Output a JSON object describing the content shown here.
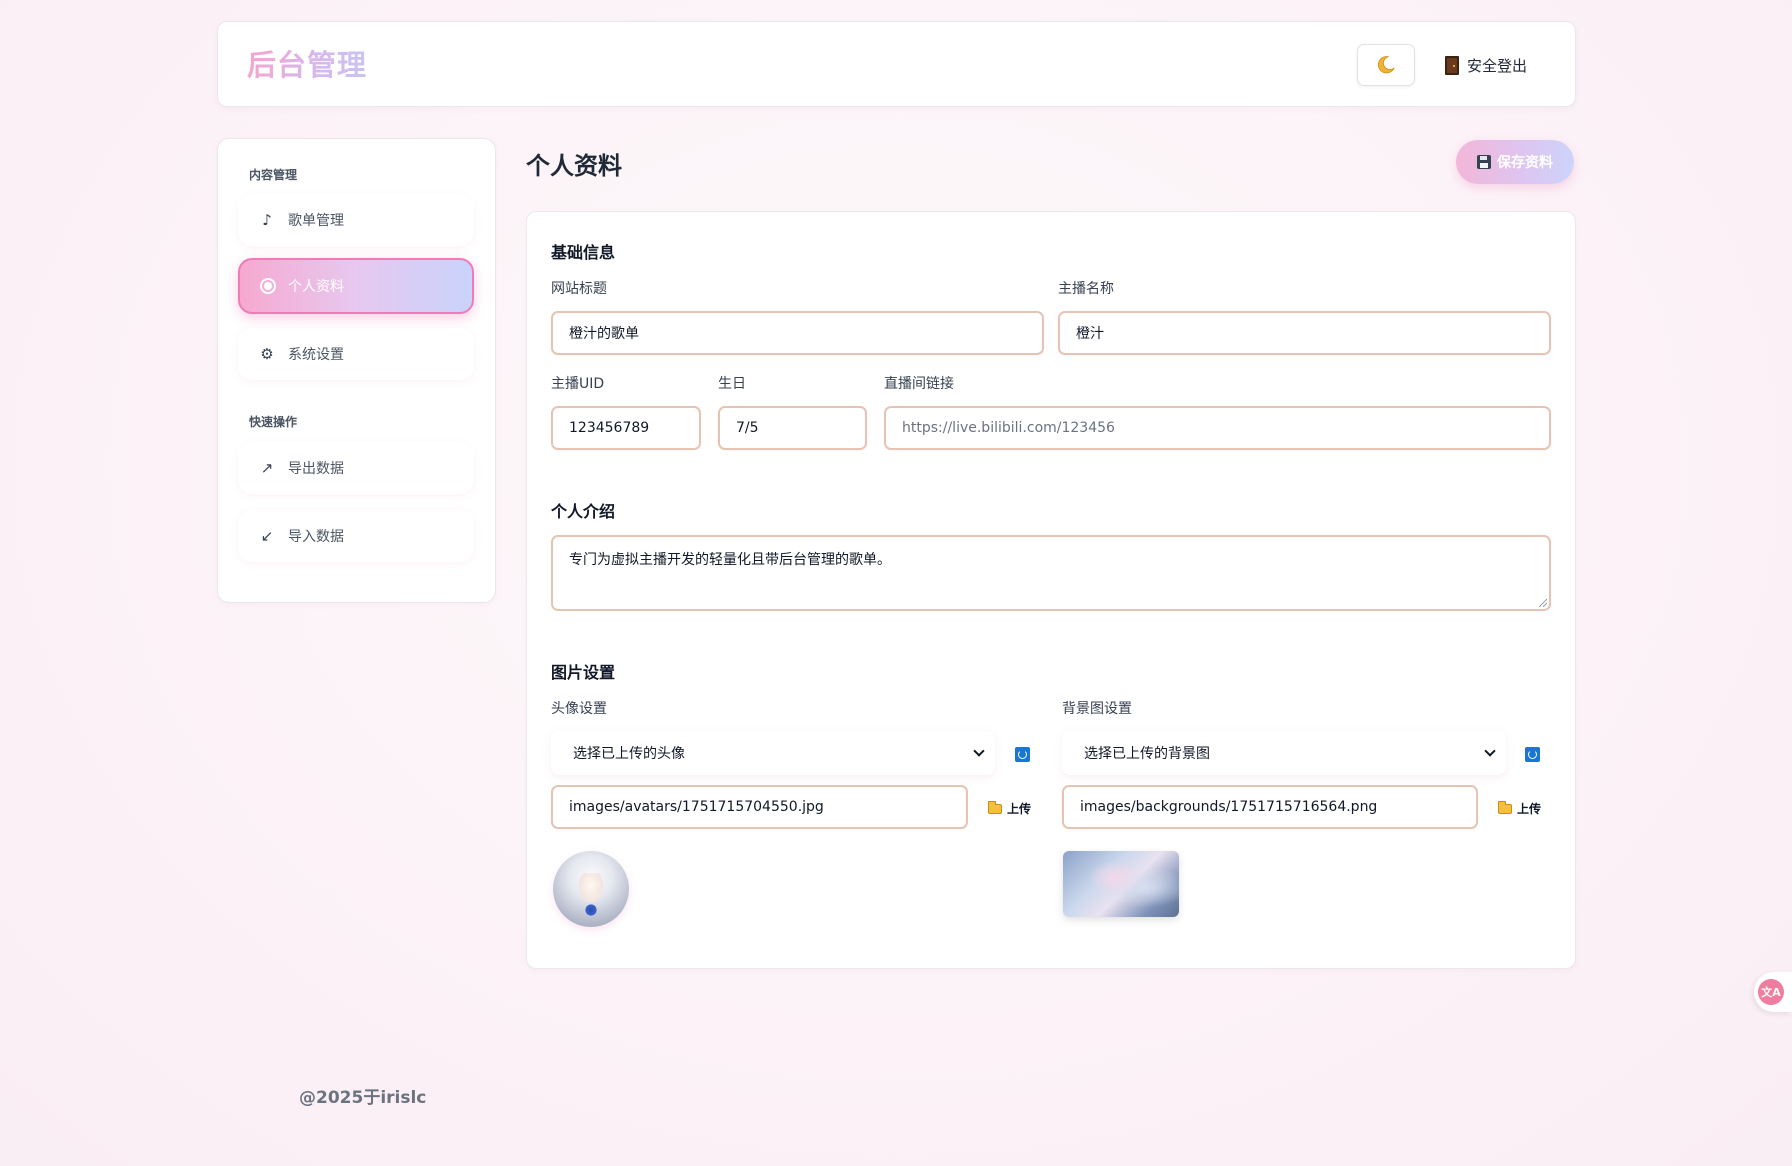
{
  "header": {
    "brand": "后台管理",
    "theme_toggle_icon": "moon-icon",
    "logout_label": "安全登出"
  },
  "sidebar": {
    "sections": [
      {
        "title": "内容管理"
      },
      {
        "title": "快速操作"
      }
    ],
    "items": [
      {
        "label": "歌单管理",
        "icon": "music-note-icon",
        "glyph": "♪"
      },
      {
        "label": "个人资料",
        "icon": "radio-icon",
        "glyph": ""
      },
      {
        "label": "系统设置",
        "icon": "gear-icon",
        "glyph": "⚙"
      },
      {
        "label": "导出数据",
        "icon": "arrow-up-right-icon",
        "glyph": "↗"
      },
      {
        "label": "导入数据",
        "icon": "arrow-down-left-icon",
        "glyph": "↙"
      }
    ],
    "active_index": 1
  },
  "main": {
    "title": "个人资料",
    "save_label": "保存资料",
    "basic": {
      "title": "基础信息",
      "site_title_label": "网站标题",
      "site_title_value": "橙汁的歌单",
      "streamer_name_label": "主播名称",
      "streamer_name_value": "橙汁",
      "uid_label": "主播UID",
      "uid_value": "123456789",
      "birthday_label": "生日",
      "birthday_value": "7/5",
      "live_url_label": "直播间链接",
      "live_url_placeholder": "https://live.bilibili.com/123456"
    },
    "intro": {
      "title": "个人介绍",
      "value": "专门为虚拟主播开发的轻量化且带后台管理的歌单。"
    },
    "images": {
      "title": "图片设置",
      "avatar_label": "头像设置",
      "avatar_select": "选择已上传的头像",
      "avatar_path": "images/avatars/1751715704550.jpg",
      "background_label": "背景图设置",
      "background_select": "选择已上传的背景图",
      "background_path": "images/backgrounds/1751715716564.png",
      "upload_label": "上传"
    }
  },
  "footer": {
    "text": "@2025于irislc"
  },
  "colors": {
    "accent_pink": "#f07bb8",
    "input_border": "#e6c4b3",
    "brand_gradient_start": "#f4a6cf",
    "brand_gradient_end": "#c9c4f3"
  }
}
